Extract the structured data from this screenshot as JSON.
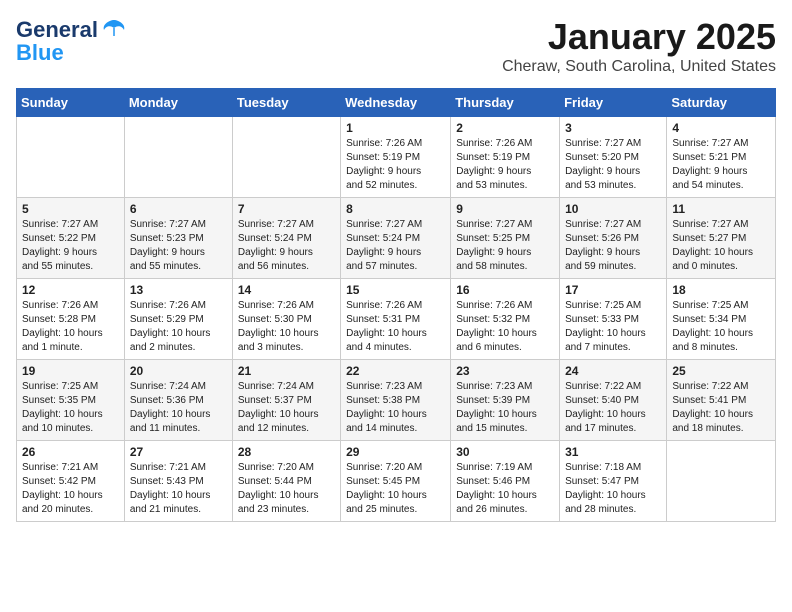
{
  "header": {
    "logo_line1": "General",
    "logo_line2": "Blue",
    "title": "January 2025",
    "subtitle": "Cheraw, South Carolina, United States"
  },
  "days_of_week": [
    "Sunday",
    "Monday",
    "Tuesday",
    "Wednesday",
    "Thursday",
    "Friday",
    "Saturday"
  ],
  "weeks": [
    [
      {
        "day": "",
        "info": ""
      },
      {
        "day": "",
        "info": ""
      },
      {
        "day": "",
        "info": ""
      },
      {
        "day": "1",
        "info": "Sunrise: 7:26 AM\nSunset: 5:19 PM\nDaylight: 9 hours\nand 52 minutes."
      },
      {
        "day": "2",
        "info": "Sunrise: 7:26 AM\nSunset: 5:19 PM\nDaylight: 9 hours\nand 53 minutes."
      },
      {
        "day": "3",
        "info": "Sunrise: 7:27 AM\nSunset: 5:20 PM\nDaylight: 9 hours\nand 53 minutes."
      },
      {
        "day": "4",
        "info": "Sunrise: 7:27 AM\nSunset: 5:21 PM\nDaylight: 9 hours\nand 54 minutes."
      }
    ],
    [
      {
        "day": "5",
        "info": "Sunrise: 7:27 AM\nSunset: 5:22 PM\nDaylight: 9 hours\nand 55 minutes."
      },
      {
        "day": "6",
        "info": "Sunrise: 7:27 AM\nSunset: 5:23 PM\nDaylight: 9 hours\nand 55 minutes."
      },
      {
        "day": "7",
        "info": "Sunrise: 7:27 AM\nSunset: 5:24 PM\nDaylight: 9 hours\nand 56 minutes."
      },
      {
        "day": "8",
        "info": "Sunrise: 7:27 AM\nSunset: 5:24 PM\nDaylight: 9 hours\nand 57 minutes."
      },
      {
        "day": "9",
        "info": "Sunrise: 7:27 AM\nSunset: 5:25 PM\nDaylight: 9 hours\nand 58 minutes."
      },
      {
        "day": "10",
        "info": "Sunrise: 7:27 AM\nSunset: 5:26 PM\nDaylight: 9 hours\nand 59 minutes."
      },
      {
        "day": "11",
        "info": "Sunrise: 7:27 AM\nSunset: 5:27 PM\nDaylight: 10 hours\nand 0 minutes."
      }
    ],
    [
      {
        "day": "12",
        "info": "Sunrise: 7:26 AM\nSunset: 5:28 PM\nDaylight: 10 hours\nand 1 minute."
      },
      {
        "day": "13",
        "info": "Sunrise: 7:26 AM\nSunset: 5:29 PM\nDaylight: 10 hours\nand 2 minutes."
      },
      {
        "day": "14",
        "info": "Sunrise: 7:26 AM\nSunset: 5:30 PM\nDaylight: 10 hours\nand 3 minutes."
      },
      {
        "day": "15",
        "info": "Sunrise: 7:26 AM\nSunset: 5:31 PM\nDaylight: 10 hours\nand 4 minutes."
      },
      {
        "day": "16",
        "info": "Sunrise: 7:26 AM\nSunset: 5:32 PM\nDaylight: 10 hours\nand 6 minutes."
      },
      {
        "day": "17",
        "info": "Sunrise: 7:25 AM\nSunset: 5:33 PM\nDaylight: 10 hours\nand 7 minutes."
      },
      {
        "day": "18",
        "info": "Sunrise: 7:25 AM\nSunset: 5:34 PM\nDaylight: 10 hours\nand 8 minutes."
      }
    ],
    [
      {
        "day": "19",
        "info": "Sunrise: 7:25 AM\nSunset: 5:35 PM\nDaylight: 10 hours\nand 10 minutes."
      },
      {
        "day": "20",
        "info": "Sunrise: 7:24 AM\nSunset: 5:36 PM\nDaylight: 10 hours\nand 11 minutes."
      },
      {
        "day": "21",
        "info": "Sunrise: 7:24 AM\nSunset: 5:37 PM\nDaylight: 10 hours\nand 12 minutes."
      },
      {
        "day": "22",
        "info": "Sunrise: 7:23 AM\nSunset: 5:38 PM\nDaylight: 10 hours\nand 14 minutes."
      },
      {
        "day": "23",
        "info": "Sunrise: 7:23 AM\nSunset: 5:39 PM\nDaylight: 10 hours\nand 15 minutes."
      },
      {
        "day": "24",
        "info": "Sunrise: 7:22 AM\nSunset: 5:40 PM\nDaylight: 10 hours\nand 17 minutes."
      },
      {
        "day": "25",
        "info": "Sunrise: 7:22 AM\nSunset: 5:41 PM\nDaylight: 10 hours\nand 18 minutes."
      }
    ],
    [
      {
        "day": "26",
        "info": "Sunrise: 7:21 AM\nSunset: 5:42 PM\nDaylight: 10 hours\nand 20 minutes."
      },
      {
        "day": "27",
        "info": "Sunrise: 7:21 AM\nSunset: 5:43 PM\nDaylight: 10 hours\nand 21 minutes."
      },
      {
        "day": "28",
        "info": "Sunrise: 7:20 AM\nSunset: 5:44 PM\nDaylight: 10 hours\nand 23 minutes."
      },
      {
        "day": "29",
        "info": "Sunrise: 7:20 AM\nSunset: 5:45 PM\nDaylight: 10 hours\nand 25 minutes."
      },
      {
        "day": "30",
        "info": "Sunrise: 7:19 AM\nSunset: 5:46 PM\nDaylight: 10 hours\nand 26 minutes."
      },
      {
        "day": "31",
        "info": "Sunrise: 7:18 AM\nSunset: 5:47 PM\nDaylight: 10 hours\nand 28 minutes."
      },
      {
        "day": "",
        "info": ""
      }
    ]
  ]
}
